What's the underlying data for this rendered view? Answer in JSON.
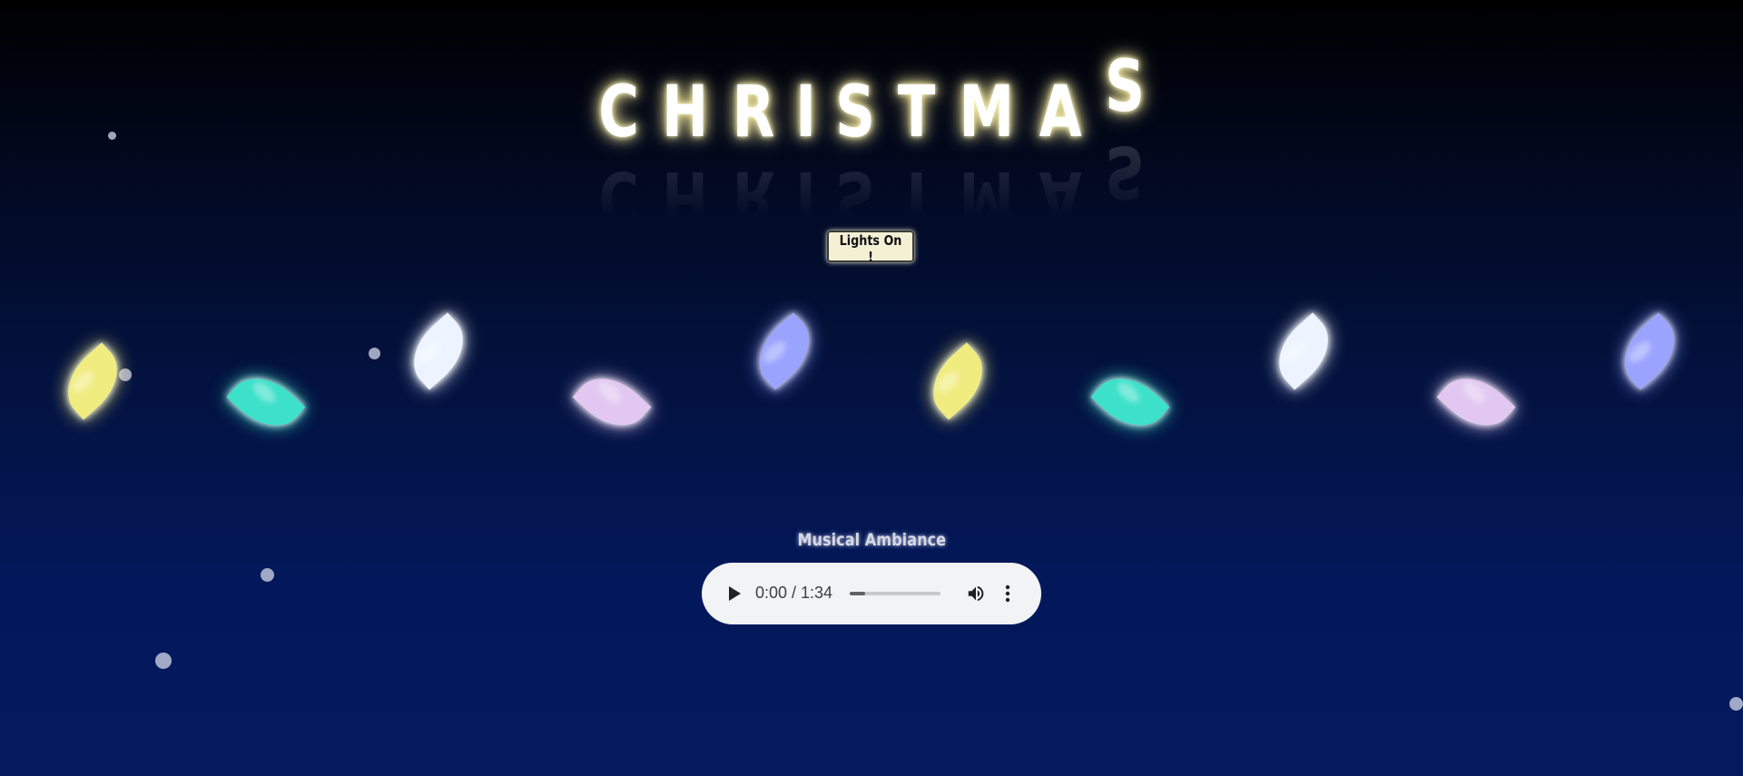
{
  "title": {
    "letters": [
      "C",
      "H",
      "R",
      "I",
      "S",
      "T",
      "M",
      "A",
      "S"
    ]
  },
  "lights_button": {
    "label": "Lights On !"
  },
  "lights": [
    {
      "color": "#f0ec80",
      "name": "light-bulb-yellow"
    },
    {
      "color": "#3de0c8",
      "name": "light-bulb-teal"
    },
    {
      "color": "#eef4ff",
      "name": "light-bulb-white"
    },
    {
      "color": "#e2c8f0",
      "name": "light-bulb-lavender"
    },
    {
      "color": "#9aa4ff",
      "name": "light-bulb-blue"
    },
    {
      "color": "#f0ec80",
      "name": "light-bulb-yellow"
    },
    {
      "color": "#3de0c8",
      "name": "light-bulb-teal"
    },
    {
      "color": "#eef4ff",
      "name": "light-bulb-white"
    },
    {
      "color": "#e2c8f0",
      "name": "light-bulb-lavender"
    },
    {
      "color": "#9aa4ff",
      "name": "light-bulb-blue"
    }
  ],
  "music": {
    "label": "Musical Ambiance",
    "time": "0:00 / 1:34",
    "progress_fraction": 0.17
  }
}
